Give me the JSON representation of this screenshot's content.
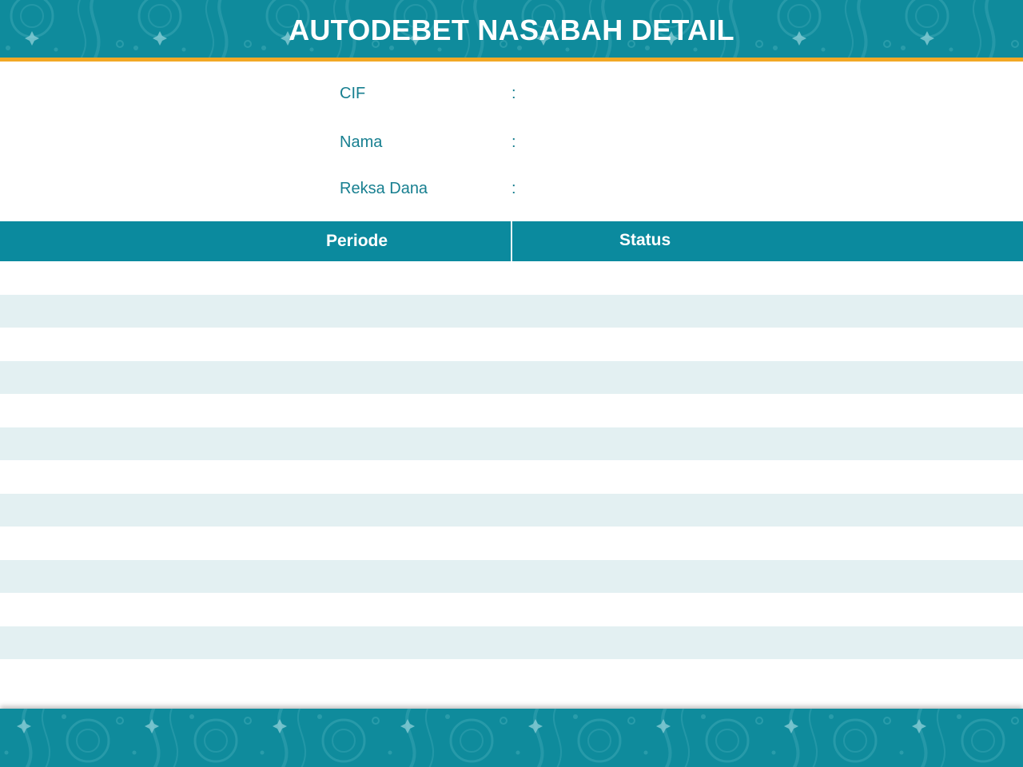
{
  "header": {
    "title": "AUTODEBET NASABAH DETAIL"
  },
  "fields": [
    {
      "label": "CIF",
      "separator": ":",
      "value": ""
    },
    {
      "label": "Nama",
      "separator": ":",
      "value": ""
    },
    {
      "label": "Reksa Dana",
      "separator": ":",
      "value": ""
    }
  ],
  "table": {
    "columns": [
      "Periode",
      "Status"
    ],
    "rows": [
      {
        "periode": "",
        "status": ""
      },
      {
        "periode": "",
        "status": ""
      },
      {
        "periode": "",
        "status": ""
      },
      {
        "periode": "",
        "status": ""
      },
      {
        "periode": "",
        "status": ""
      },
      {
        "periode": "",
        "status": ""
      },
      {
        "periode": "",
        "status": ""
      },
      {
        "periode": "",
        "status": ""
      },
      {
        "periode": "",
        "status": ""
      },
      {
        "periode": "",
        "status": ""
      },
      {
        "periode": "",
        "status": ""
      },
      {
        "periode": "",
        "status": ""
      }
    ]
  },
  "colors": {
    "header_teal": "#0f8b9c",
    "accent_orange": "#f2a825",
    "table_head_teal": "#0b8a9e",
    "row_stripe": "#e3f0f2",
    "label_text": "#177f90"
  },
  "icons": {
    "header_pattern": "batik-flower-pattern",
    "footer_pattern": "batik-flower-pattern"
  }
}
